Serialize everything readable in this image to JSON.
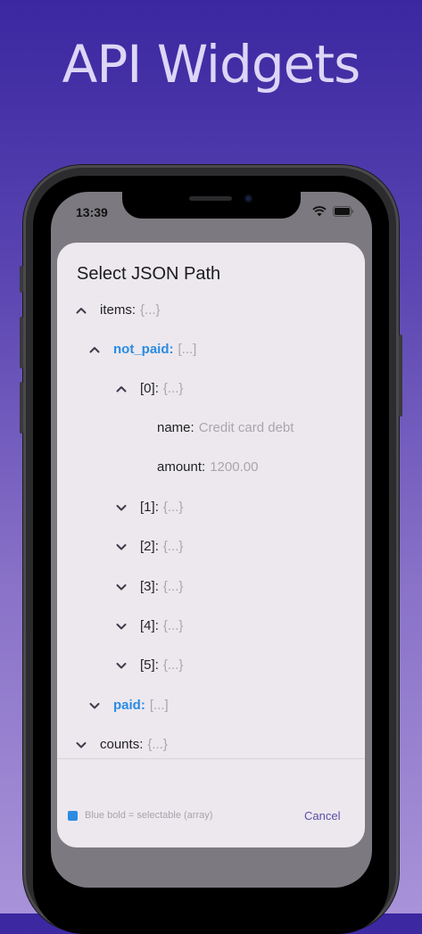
{
  "headline": "API Widgets",
  "status_bar": {
    "time": "13:39"
  },
  "dialog": {
    "title": "Select JSON Path",
    "rows": [
      {
        "key": "items",
        "value": "{...}",
        "chevron": "up",
        "selectable": false
      },
      {
        "key": "not_paid",
        "value": "[...]",
        "chevron": "up",
        "selectable": true
      },
      {
        "key": "[0]",
        "value": "{...}",
        "chevron": "up",
        "selectable": false
      },
      {
        "key": "name",
        "value": "Credit card debt",
        "chevron": "none",
        "selectable": false
      },
      {
        "key": "amount",
        "value": "1200.00",
        "chevron": "none",
        "selectable": false
      },
      {
        "key": "[1]",
        "value": "{...}",
        "chevron": "down",
        "selectable": false
      },
      {
        "key": "[2]",
        "value": "{...}",
        "chevron": "down",
        "selectable": false
      },
      {
        "key": "[3]",
        "value": "{...}",
        "chevron": "down",
        "selectable": false
      },
      {
        "key": "[4]",
        "value": "{...}",
        "chevron": "down",
        "selectable": false
      },
      {
        "key": "[5]",
        "value": "{...}",
        "chevron": "down",
        "selectable": false
      },
      {
        "key": "paid",
        "value": "[...]",
        "chevron": "down",
        "selectable": true
      },
      {
        "key": "counts",
        "value": "{...}",
        "chevron": "down",
        "selectable": false
      }
    ],
    "legend": "Blue bold = selectable (array)",
    "cancel_label": "Cancel"
  },
  "colors": {
    "accent": "#2a8be2",
    "cancel": "#5b4ea6"
  },
  "icons": {
    "chevron_up": "chevron-up-icon",
    "chevron_down": "chevron-down-icon",
    "wifi": "wifi-icon",
    "battery": "battery-icon"
  }
}
